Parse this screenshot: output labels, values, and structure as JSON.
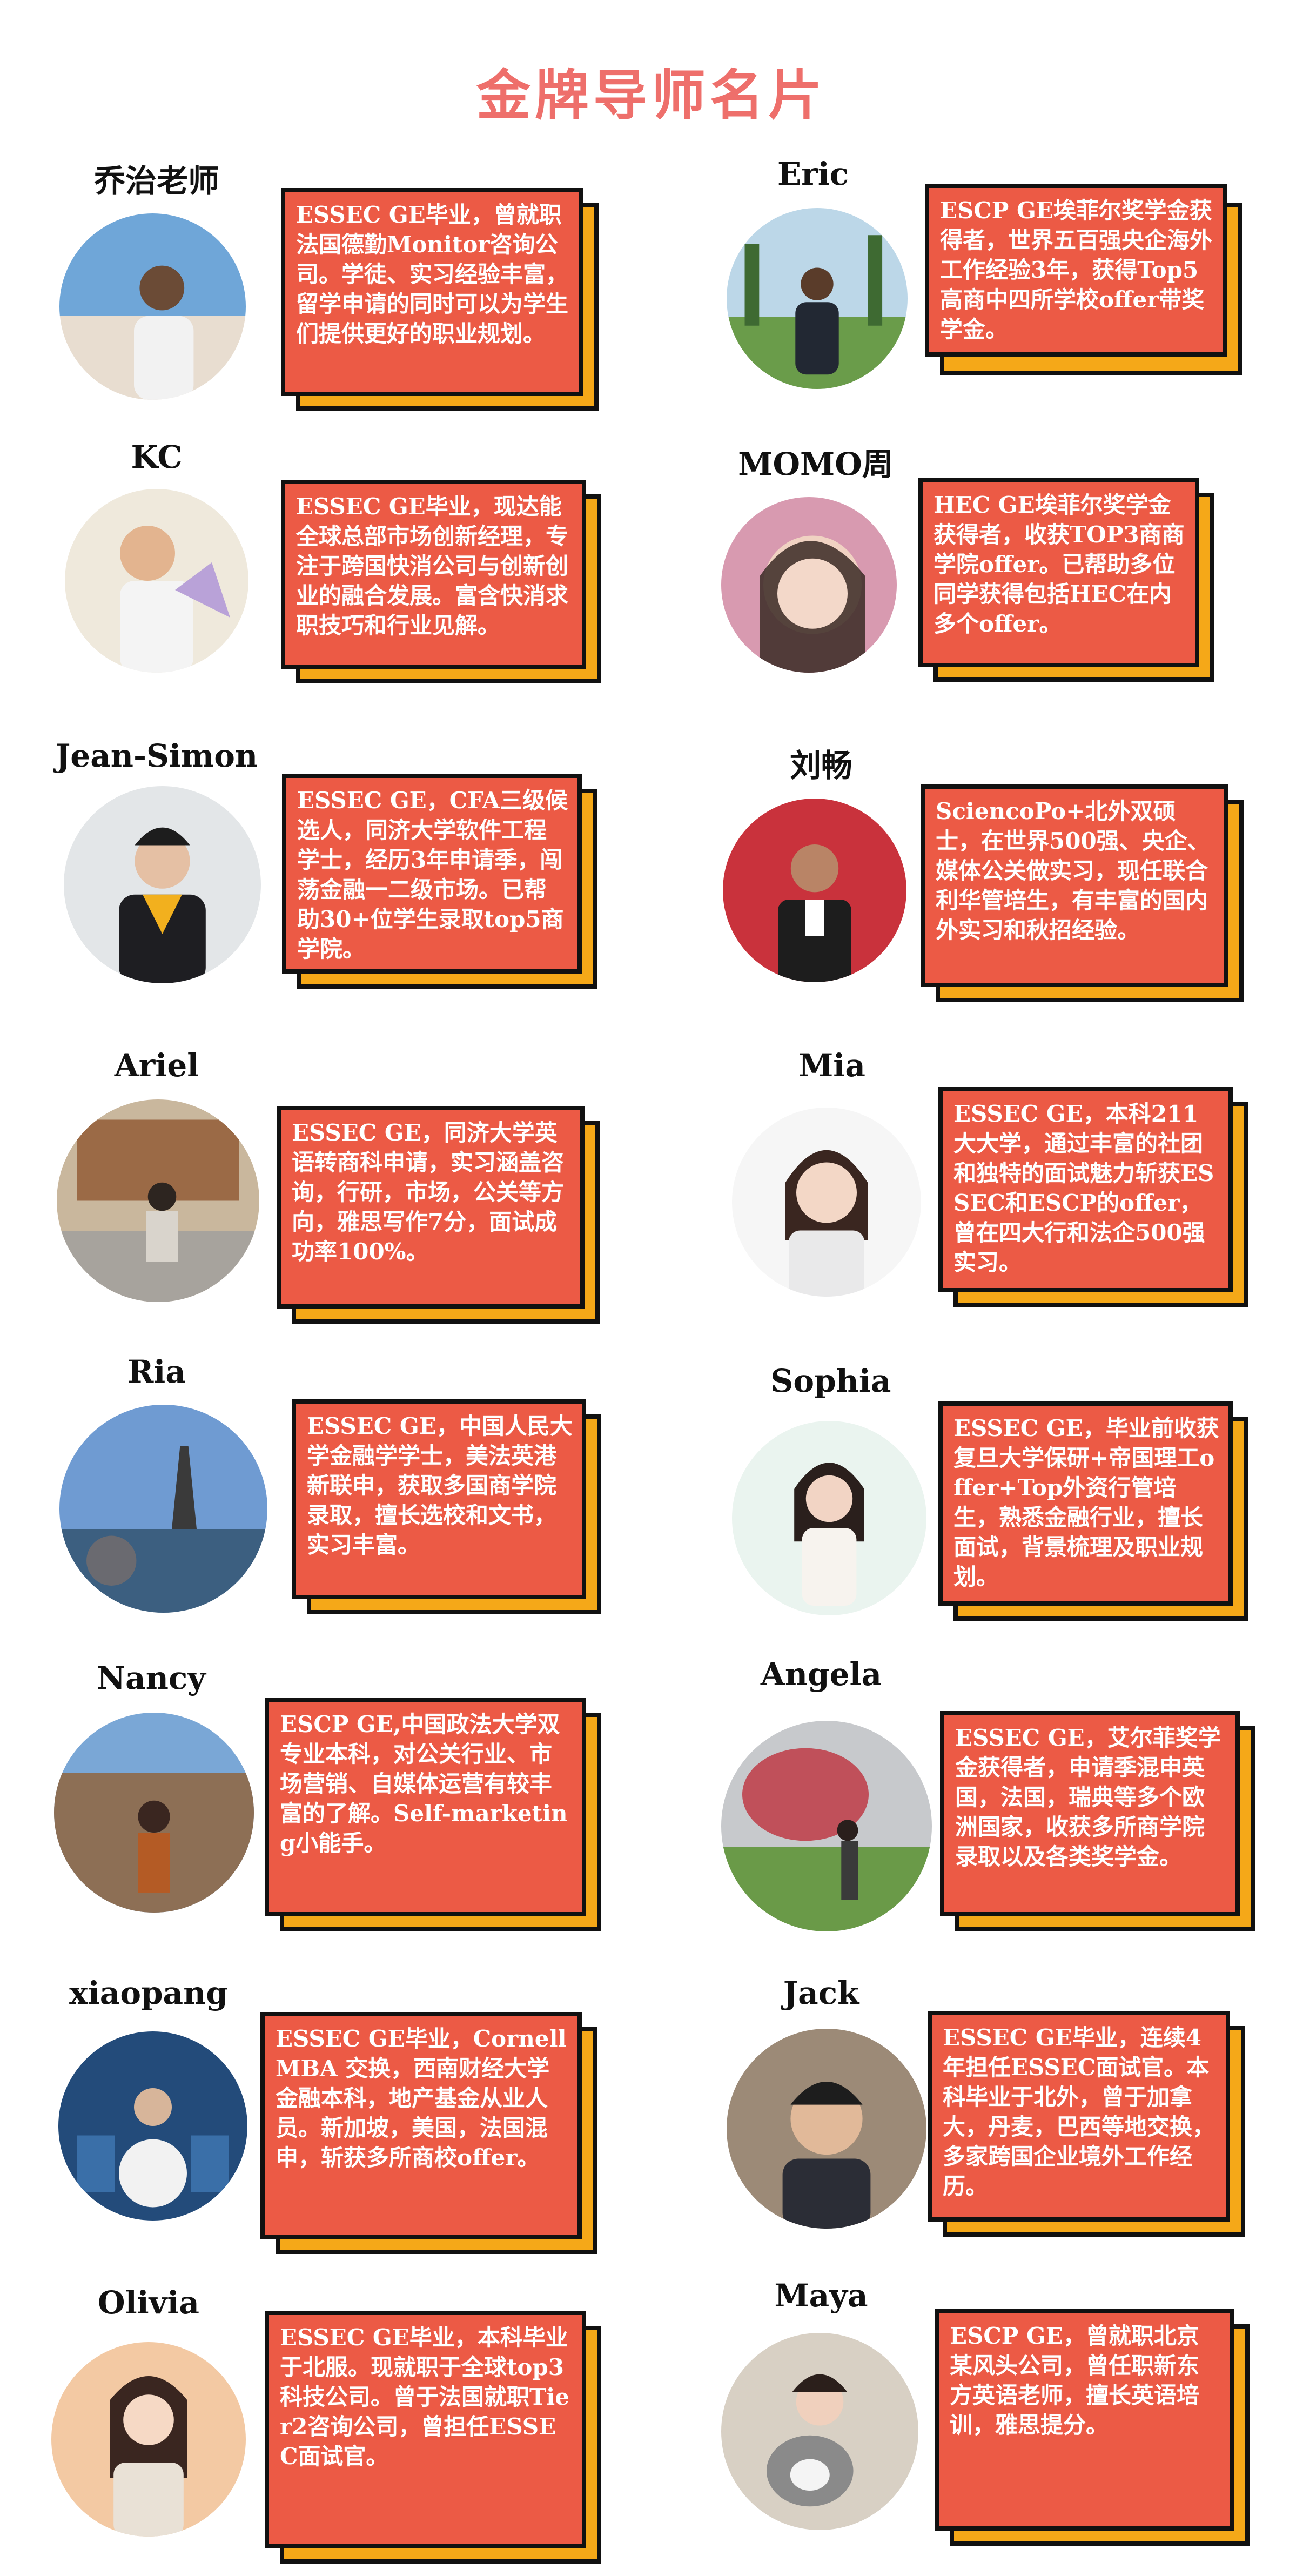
{
  "title": "金牌导师名片",
  "colors": {
    "title": "#ee6f6b",
    "card": "#ec5a45",
    "card_shadow": "#f5a818",
    "border": "#111111"
  },
  "mentors": [
    {
      "name": "乔治老师",
      "bio": "ESSEC GE毕业，曾就职法国德勤Monitor咨询公司。学徒、实习经验丰富，留学申请的同时可以为学生们提供更好的职业规划。"
    },
    {
      "name": "Eric",
      "bio": "ESCP GE埃菲尔奖学金获得者，世界五百强央企海外工作经验3年，获得Top5高商中四所学校offer带奖学金。"
    },
    {
      "name": "KC",
      "bio": "ESSEC GE毕业，现达能全球总部市场创新经理，专注于跨国快消公司与创新创业的融合发展。富含快消求职技巧和行业见解。"
    },
    {
      "name": "MOMO周",
      "bio": "HEC GE埃菲尔奖学金获得者，收获TOP3商商学院offer。已帮助多位同学获得包括HEC在内多个offer。"
    },
    {
      "name": "Jean-Simon",
      "bio": "ESSEC GE，CFA三级候选人，同济大学软件工程学士，经历3年申请季，闯荡金融一二级市场。已帮助30+位学生录取top5商学院。"
    },
    {
      "name": "刘畅",
      "bio": "SciencoPo+北外双硕士，在世界500强、央企、媒体公关做实习，现任联合利华管培生，有丰富的国内外实习和秋招经验。"
    },
    {
      "name": "Ariel",
      "bio": "ESSEC GE，同济大学英语转商科申请，实习涵盖咨询，行研，市场，公关等方向，雅思写作7分，面试成功率100%。"
    },
    {
      "name": "Mia",
      "bio": "ESSEC GE，本科211大大学，通过丰富的社团和独特的面试魅力斩获ESSEC和ESCP的offer，曾在四大行和法企500强实习。"
    },
    {
      "name": "Ria",
      "bio": "ESSEC GE，中国人民大学金融学学士，美法英港新联申，获取多国商学院录取，擅长选校和文书，实习丰富。"
    },
    {
      "name": "Sophia",
      "bio": "ESSEC GE，毕业前收获复旦大学保研+帝国理工offer+Top外资行管培生，熟悉金融行业，擅长面试，背景梳理及职业规划。"
    },
    {
      "name": "Nancy",
      "bio": "ESCP GE,中国政法大学双专业本科，对公关行业、市场营销、自媒体运营有较丰富的了解。Self-marketing小能手。"
    },
    {
      "name": "Angela",
      "bio": "ESSEC GE，艾尔菲奖学金获得者，申请季混申英国，法国，瑞典等多个欧洲国家，收获多所商学院录取以及各类奖学金。"
    },
    {
      "name": "xiaopang",
      "bio": "ESSEC GE毕业，Cornell MBA 交换，西南财经大学金融本科，地产基金从业人员。新加坡，美国，法国混申，斩获多所商校offer。"
    },
    {
      "name": "Jack",
      "bio": "ESSEC GE毕业，连续4年担任ESSEC面试官。本科毕业于北外，曾于加拿大，丹麦，巴西等地交换，多家跨国企业境外工作经历。"
    },
    {
      "name": "Olivia",
      "bio": "ESSEC GE毕业，本科毕业于北服。现就职于全球top3科技公司。曾于法国就职Tier2咨询公司，曾担任ESSEC面试官。"
    },
    {
      "name": "Maya",
      "bio": "ESCP GE，曾就职北京某风头公司，曾任职新东方英语老师，擅长英语培训，雅思提分。"
    }
  ]
}
